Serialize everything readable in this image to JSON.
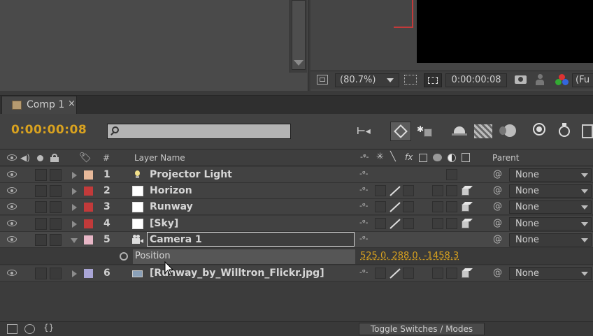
{
  "viewer": {
    "zoom_label": "(80.7%)",
    "timecode": "0:00:00:08",
    "resolution_label": "(Fu"
  },
  "tab": {
    "label": "Comp 1",
    "close_glyph": "×"
  },
  "timeline": {
    "current_time": "0:00:00:08",
    "search_placeholder": ""
  },
  "header": {
    "number_col": "#",
    "layer_name_col": "Layer Name",
    "switches_col": "fx",
    "parent_col": "Parent"
  },
  "layers": [
    {
      "num": "1",
      "name": "Projector Light",
      "color": "#e7b99a",
      "icon": "light-bulb-icon",
      "parent": "None"
    },
    {
      "num": "2",
      "name": "Horizon",
      "color": "#c23a3a",
      "icon": "solid-white-icon",
      "parent": "None"
    },
    {
      "num": "3",
      "name": "Runway",
      "color": "#c23a3a",
      "icon": "solid-white-icon",
      "parent": "None"
    },
    {
      "num": "4",
      "name": "[Sky]",
      "color": "#c23a3a",
      "icon": "solid-white-icon",
      "parent": "None"
    },
    {
      "num": "5",
      "name": "Camera 1",
      "color": "#e7b6c6",
      "icon": "camera-icon",
      "parent": "None"
    },
    {
      "num": "6",
      "name": "[Runway_by_Willtron_Flickr.jpg]",
      "color": "#a9a5d6",
      "icon": "footage-icon",
      "parent": "None"
    }
  ],
  "position_property": {
    "label": "Position",
    "value": "525.0, 288.0, -1458.3"
  },
  "footer": {
    "toggle_label": "Toggle Switches / Modes"
  },
  "colors": {
    "accent": "#d9a21f",
    "selected_row": "#5a5a5a"
  }
}
